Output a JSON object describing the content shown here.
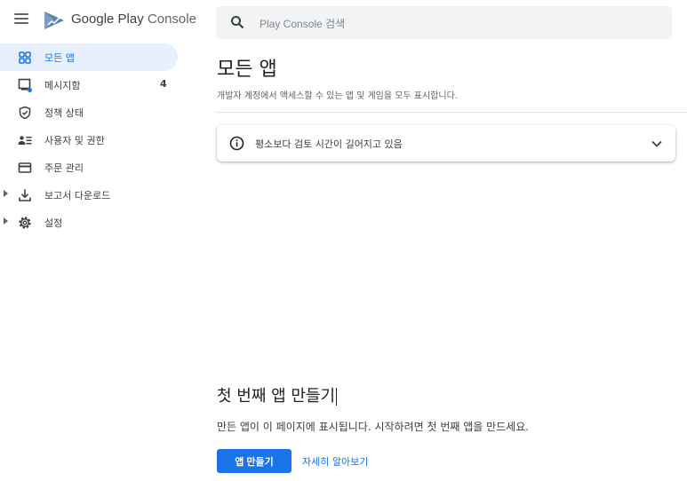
{
  "app": {
    "brand_primary": "Google Play",
    "brand_secondary": "Console"
  },
  "sidebar": {
    "items": [
      {
        "label": "모든 앱",
        "icon": "grid-icon",
        "active": true
      },
      {
        "label": "메시지함",
        "icon": "inbox-icon",
        "badge": "4"
      },
      {
        "label": "정책 상태",
        "icon": "shield-check-icon"
      },
      {
        "label": "사용자 및 권한",
        "icon": "users-icon"
      },
      {
        "label": "주문 관리",
        "icon": "credit-card-icon"
      },
      {
        "label": "보고서 다운로드",
        "icon": "download-icon",
        "expandable": true
      },
      {
        "label": "설정",
        "icon": "gear-icon",
        "expandable": true
      }
    ]
  },
  "search": {
    "placeholder": "Play Console 검색"
  },
  "main": {
    "title": "모든 앱",
    "subtitle": "개발자 계정에서 액세스할 수 있는 앱 및 게임을 모두 표시합니다.",
    "notice": "평소보다 검토 시간이 길어지고 있음",
    "empty_title": "첫 번째 앱 만들기",
    "empty_subtitle": "만든 앱이 이 페이지에 표시됩니다. 시작하려면 첫 번째 앱을 만드세요.",
    "create_button": "앱 만들기",
    "learn_more": "자세히 알아보기"
  },
  "colors": {
    "accent": "#1a73e8",
    "active_bg": "#e8f0fe",
    "search_bg": "#f1f3f4"
  }
}
